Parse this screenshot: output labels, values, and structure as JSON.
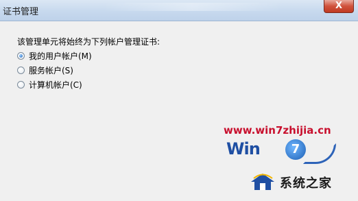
{
  "window": {
    "title": "证书管理",
    "close_label": "X"
  },
  "prompt": "该管理单元将始终为下列帐户管理证书:",
  "options": [
    {
      "label": "我的用户帐户(M)",
      "checked": true
    },
    {
      "label": "服务帐户(S)",
      "checked": false
    },
    {
      "label": "计算机帐户(C)",
      "checked": false
    }
  ],
  "watermark": {
    "url": "www.win7zhijia.cn",
    "logo_text": "Win",
    "logo_digit": "7",
    "brand": "系统之家"
  },
  "colors": {
    "titlebar": "#c7d9ee",
    "close_button": "#d0523c",
    "watermark_url": "#c8102e",
    "watermark_logo": "#1f4fa3"
  }
}
